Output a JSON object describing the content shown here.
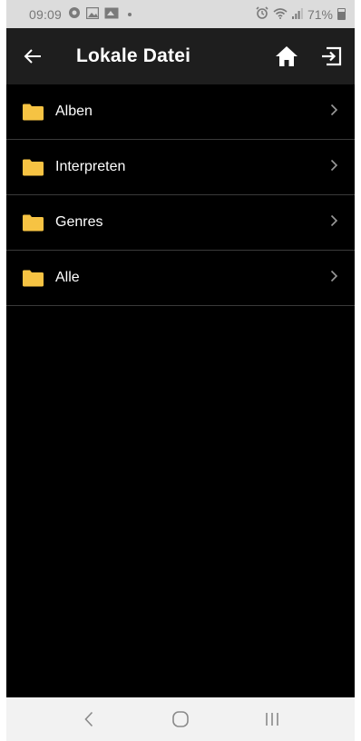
{
  "status_bar": {
    "time": "09:09",
    "battery": "71%"
  },
  "app_bar": {
    "title": "Lokale Datei"
  },
  "list": {
    "items": [
      {
        "label": "Alben"
      },
      {
        "label": "Interpreten"
      },
      {
        "label": "Genres"
      },
      {
        "label": "Alle"
      }
    ]
  },
  "icons": {
    "back": "arrow-left-icon",
    "home": "home-icon",
    "exit": "exit-icon",
    "folder": "folder-icon",
    "chevron": "chevron-right-icon"
  },
  "colors": {
    "folder": "#f6c343",
    "app_bar": "#1e1e1e",
    "background": "#000000",
    "status_bar": "#dcdcdc"
  }
}
